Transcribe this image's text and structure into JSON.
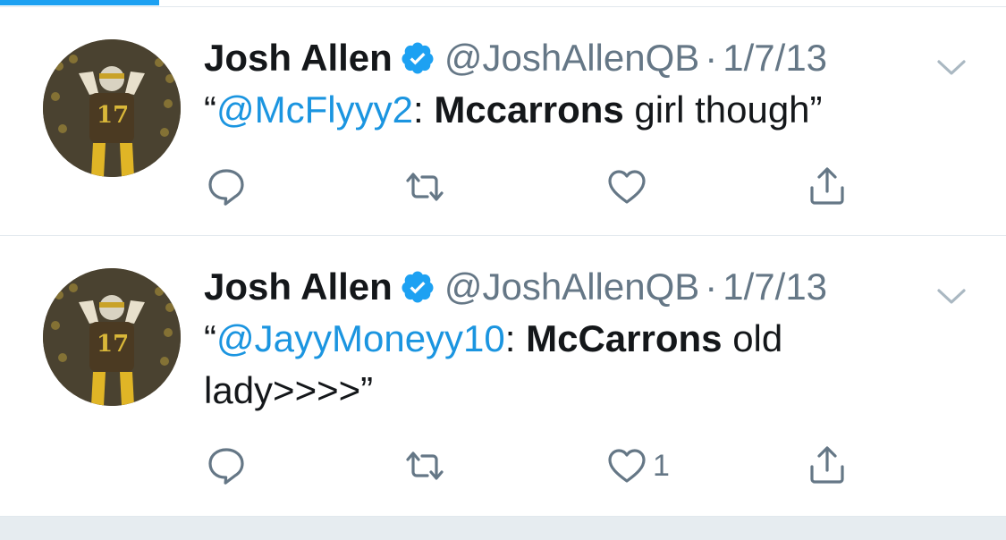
{
  "colors": {
    "accent": "#1da1f2",
    "link": "#1b95e0",
    "muted": "#657786",
    "text": "#14171a"
  },
  "tweets": [
    {
      "name": "Josh Allen",
      "handle": "@JoshAllenQB",
      "separator": "·",
      "date": "1/7/13",
      "avatar_jersey_number": "17",
      "text": {
        "open_quote": "“",
        "mention": "@McFlyyy2",
        "colon": ": ",
        "bold": "Mccarrons",
        "rest": " girl though”"
      },
      "actions": {
        "reply": "reply-icon",
        "retweet": "retweet-icon",
        "like": "heart-icon",
        "like_count": "",
        "share": "share-icon"
      }
    },
    {
      "name": "Josh Allen",
      "handle": "@JoshAllenQB",
      "separator": "·",
      "date": "1/7/13",
      "avatar_jersey_number": "17",
      "text": {
        "open_quote": "“",
        "mention": "@JayyMoneyy10",
        "colon": ": ",
        "bold": "McCarrons",
        "rest": " old lady>>>>”"
      },
      "actions": {
        "reply": "reply-icon",
        "retweet": "retweet-icon",
        "like": "heart-icon",
        "like_count": "1",
        "share": "share-icon"
      }
    }
  ]
}
